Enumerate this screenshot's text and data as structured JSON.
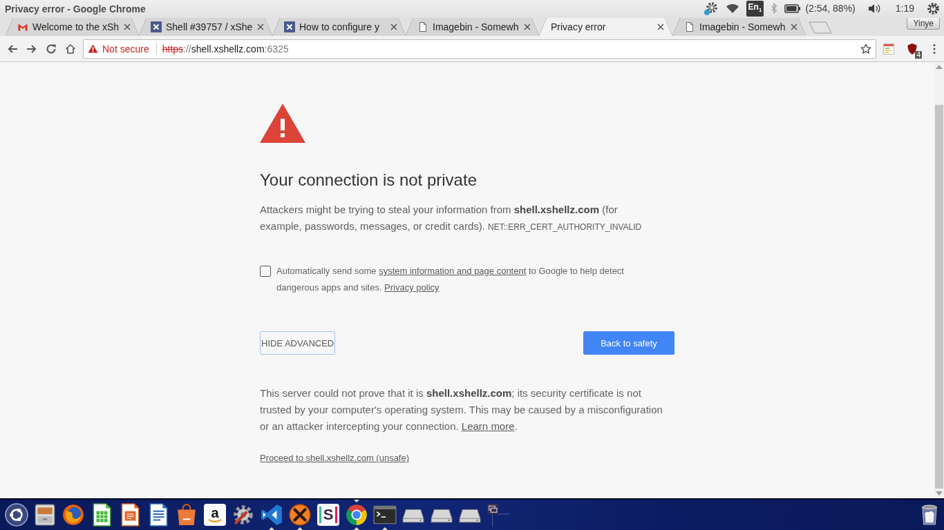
{
  "top_panel": {
    "window_title": "Privacy error - Google Chrome",
    "keyboard_layout": "En$_{1}$",
    "battery": "(2:54, 88%)",
    "clock": "1:19"
  },
  "tabs": [
    {
      "title": "Welcome to the xSh",
      "kind": "mail",
      "selected": false
    },
    {
      "title": "Shell #39757 / xShe",
      "kind": "x",
      "selected": false
    },
    {
      "title": "How to configure y",
      "kind": "x",
      "selected": false
    },
    {
      "title": "Imagebin - Somewh",
      "kind": "page",
      "selected": false
    },
    {
      "title": "Privacy error",
      "kind": "plain",
      "selected": true
    },
    {
      "title": "Imagebin - Somewh",
      "kind": "page",
      "selected": false
    }
  ],
  "profile": {
    "name": "Yinye"
  },
  "address_bar": {
    "security_label": "Not secure",
    "scheme": "https",
    "separator": "://",
    "host": "shell.xshellz.com",
    "port": ":6325"
  },
  "extensions": [
    {
      "kind": "card"
    },
    {
      "kind": "shield",
      "badge": "4"
    }
  ],
  "page": {
    "heading": "Your connection is not private",
    "intro": "Attackers might be trying to steal your information from **shell.xshellz.com** (for example, passwords, messages, or credit cards).",
    "error_code": "NET::ERR_CERT_AUTHORITY_INVALID",
    "report_option": {
      "checked": false,
      "parts": [
        {
          "kind": "text",
          "text": "Automatically send some "
        },
        {
          "kind": "link",
          "text": "system information and page content"
        },
        {
          "kind": "text",
          "text": " to Google to help detect dangerous apps and sites. "
        },
        {
          "kind": "link",
          "text": "Privacy policy"
        }
      ]
    },
    "buttons": [
      {
        "label": "HIDE ADVANCED",
        "kind": "secondary",
        "focused": true
      },
      {
        "label": "Back to safety",
        "kind": "primary",
        "focused": false
      }
    ],
    "details": [
      {
        "kind": "text",
        "text": "This server could not prove that it is **shell.xshellz.com**; its security certificate is not trusted by your computer's operating system. This may be caused by a misconfiguration or an attacker intercepting your connection. "
      },
      {
        "kind": "link",
        "text": "Learn more"
      },
      {
        "kind": "text",
        "text": "."
      }
    ],
    "proceed_link": "Proceed to shell.xshellz.com (unsafe)"
  },
  "launcher": [
    {
      "kind": "dash",
      "running": false,
      "focused": false
    },
    {
      "kind": "files",
      "running": false,
      "focused": false
    },
    {
      "kind": "firefox",
      "running": false,
      "focused": false
    },
    {
      "kind": "spreadsheet",
      "running": false,
      "focused": false
    },
    {
      "kind": "presentation",
      "running": false,
      "focused": false
    },
    {
      "kind": "writer",
      "running": false,
      "focused": false
    },
    {
      "kind": "store",
      "running": false,
      "focused": false
    },
    {
      "kind": "amazon",
      "glyph": "a",
      "running": false,
      "focused": false
    },
    {
      "kind": "settings",
      "running": false,
      "focused": false
    },
    {
      "kind": "code",
      "running": true,
      "focused": false
    },
    {
      "kind": "xampp",
      "running": true,
      "focused": false
    },
    {
      "kind": "slack",
      "glyph": "S",
      "running": false,
      "focused": false
    },
    {
      "kind": "chrome",
      "running": true,
      "focused": true
    },
    {
      "kind": "terminal",
      "running": true,
      "focused": false
    },
    {
      "kind": "drive",
      "running": false,
      "focused": false
    },
    {
      "kind": "drive",
      "running": false,
      "focused": false
    },
    {
      "kind": "drive",
      "running": false,
      "focused": false
    },
    {
      "kind": "workspaces",
      "running": false,
      "focused": false
    }
  ]
}
